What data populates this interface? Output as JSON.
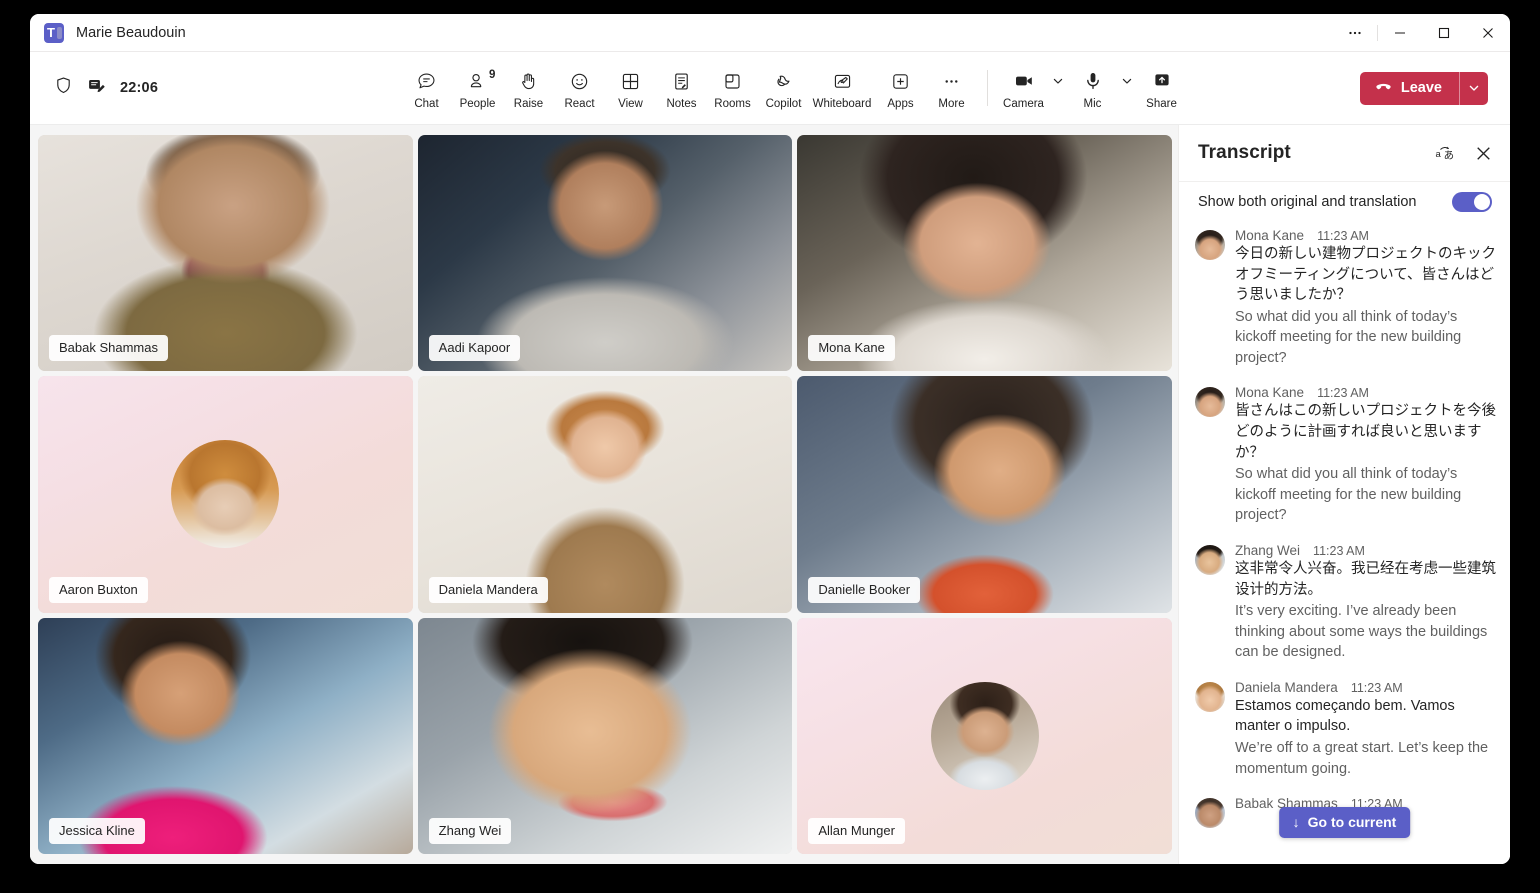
{
  "window": {
    "app_icon": "teams-logo-icon",
    "title": "Marie Beaudouin",
    "controls": {
      "more": "···",
      "minimize": "minimize-icon",
      "maximize": "maximize-icon",
      "close": "close-icon"
    }
  },
  "toolbar": {
    "shield_icon": "shield-icon",
    "notes_icon": "meeting-notes-icon",
    "clock": "22:06",
    "items": [
      {
        "label": "Chat",
        "icon": "chat-icon"
      },
      {
        "label": "People",
        "icon": "people-icon",
        "badge": "9"
      },
      {
        "label": "Raise",
        "icon": "raise-hand-icon"
      },
      {
        "label": "React",
        "icon": "react-smiley-icon"
      },
      {
        "label": "View",
        "icon": "view-grid-icon"
      },
      {
        "label": "Notes",
        "icon": "notes-icon"
      },
      {
        "label": "Rooms",
        "icon": "breakout-rooms-icon"
      },
      {
        "label": "Copilot",
        "icon": "copilot-icon"
      },
      {
        "label": "Whiteboard",
        "icon": "whiteboard-icon"
      },
      {
        "label": "Apps",
        "icon": "apps-plus-icon"
      },
      {
        "label": "More",
        "icon": "more-ellipsis-icon"
      }
    ],
    "device_items": [
      {
        "label": "Camera",
        "icon": "camera-icon",
        "has_chevron": true
      },
      {
        "label": "Mic",
        "icon": "microphone-icon",
        "has_chevron": true
      },
      {
        "label": "Share",
        "icon": "share-screen-icon",
        "has_chevron": false
      }
    ],
    "leave": {
      "label": "Leave",
      "icon": "hangup-phone-icon",
      "chevron": "chevron-down-icon",
      "color": "#c4314b"
    }
  },
  "stage": {
    "rows": [
      [
        {
          "name": "Babak Shammas",
          "kind": "video",
          "style": "babak"
        },
        {
          "name": "Aadi Kapoor",
          "kind": "video",
          "style": "aadi"
        },
        {
          "name": "Mona Kane",
          "kind": "video",
          "style": "mona"
        }
      ],
      [
        {
          "name": "Aaron Buxton",
          "kind": "avatar",
          "style": "aaron"
        },
        {
          "name": "Daniela Mandera",
          "kind": "video",
          "style": "daniela"
        },
        {
          "name": "Danielle Booker",
          "kind": "video",
          "style": "danielle"
        }
      ],
      [
        {
          "name": "Jessica Kline",
          "kind": "video",
          "style": "jessica"
        },
        {
          "name": "Zhang Wei",
          "kind": "video",
          "style": "zhang"
        },
        {
          "name": "Allan Munger",
          "kind": "avatar",
          "style": "allan"
        }
      ]
    ]
  },
  "transcript": {
    "title": "Transcript",
    "translate_icon": "translate-language-icon",
    "close_icon": "close-icon",
    "toggle_label": "Show both original and translation",
    "toggle_on": true,
    "accent": "#5b5fc7",
    "go_to_current": {
      "label": "Go to current",
      "arrow": "↓"
    },
    "entries": [
      {
        "speaker": "Mona Kane",
        "time": "11:23 AM",
        "avatar": "mona",
        "original": "今日の新しい建物プロジェクトのキックオフミーティングについて、皆さんはどう思いましたか？",
        "translation": "So what did you all think of today’s kickoff meeting for the new building project?"
      },
      {
        "speaker": "Mona Kane",
        "time": "11:23 AM",
        "avatar": "mona",
        "original": "皆さんはこの新しいプロジェクトを今後どのように計画すれば良いと思いますか？",
        "translation": "So what did you all think of today’s kickoff meeting for the new building project?"
      },
      {
        "speaker": "Zhang Wei",
        "time": "11:23 AM",
        "avatar": "zhang",
        "original": "这非常令人兴奋。我已经在考虑一些建筑设计的方法。",
        "translation": "It’s very exciting. I’ve already been thinking about some ways the buildings can be designed."
      },
      {
        "speaker": "Daniela Mandera",
        "time": "11:23 AM",
        "avatar": "daniela",
        "original": "Estamos começando bem. Vamos manter o impulso.",
        "translation": "We’re off to a great start. Let’s keep the momentum going."
      },
      {
        "speaker": "Babak Shammas",
        "time": "11:23 AM",
        "avatar": "babak",
        "original": "",
        "translation": ""
      }
    ]
  }
}
